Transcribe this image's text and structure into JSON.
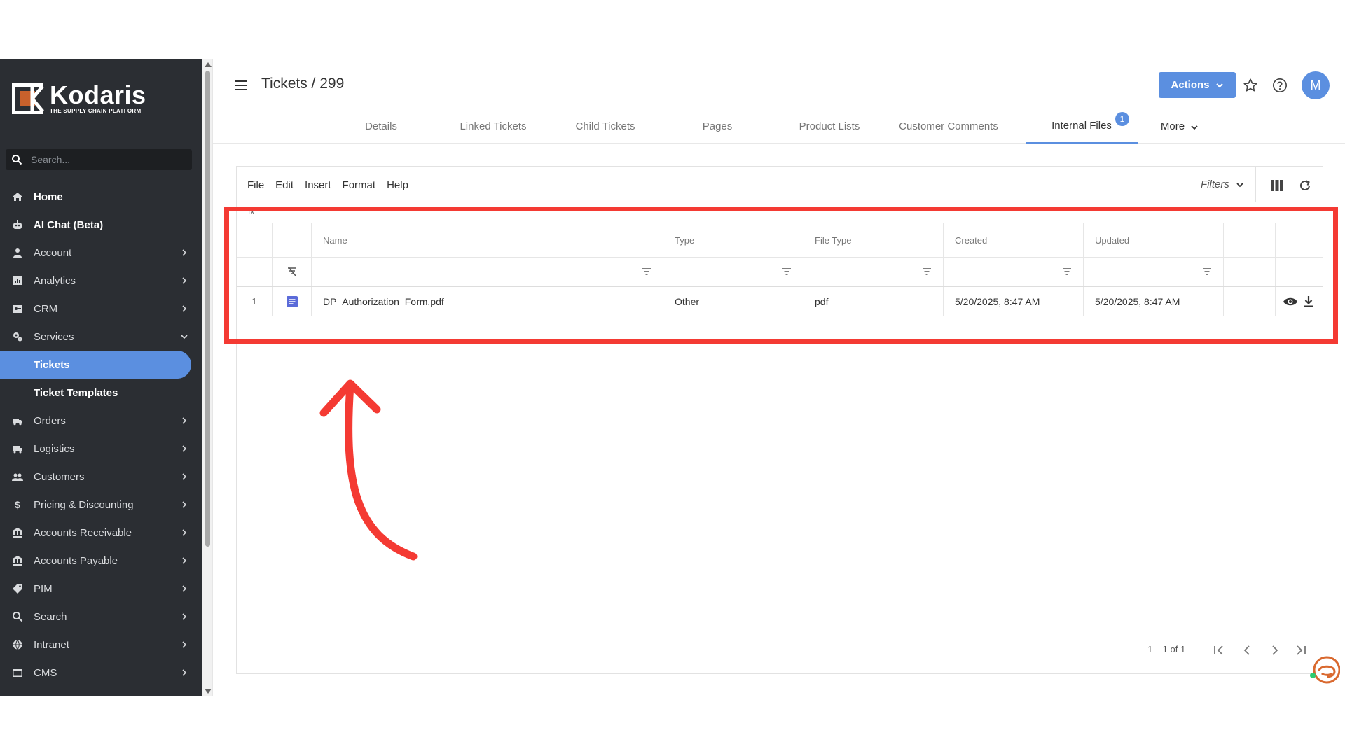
{
  "brand": {
    "name": "Kodaris",
    "tagline": "THE SUPPLY CHAIN PLATFORM",
    "accent": "#5b8fe0",
    "logo_orange": "#c8612c",
    "highlight_color": "#f43a33"
  },
  "sidebar": {
    "search_placeholder": "Search...",
    "items": [
      {
        "label": "Home",
        "icon": "home-icon",
        "chevron": false,
        "style": "bold"
      },
      {
        "label": "AI Chat (Beta)",
        "icon": "robot-icon",
        "chevron": false,
        "style": "bold"
      },
      {
        "label": "Account",
        "icon": "user-icon",
        "chevron": "right"
      },
      {
        "label": "Analytics",
        "icon": "chart-icon",
        "chevron": "right"
      },
      {
        "label": "CRM",
        "icon": "contact-card-icon",
        "chevron": "right"
      },
      {
        "label": "Services",
        "icon": "gears-icon",
        "chevron": "down"
      },
      {
        "label": "Tickets",
        "icon": null,
        "chevron": false,
        "style": "active"
      },
      {
        "label": "Ticket Templates",
        "icon": null,
        "chevron": false,
        "style": "sub"
      },
      {
        "label": "Orders",
        "icon": "truck-icon",
        "chevron": "right"
      },
      {
        "label": "Logistics",
        "icon": "shipping-icon",
        "chevron": "right"
      },
      {
        "label": "Customers",
        "icon": "users-icon",
        "chevron": "right"
      },
      {
        "label": "Pricing & Discounting",
        "icon": "dollar-icon",
        "chevron": "right"
      },
      {
        "label": "Accounts Receivable",
        "icon": "bank-icon",
        "chevron": "right"
      },
      {
        "label": "Accounts Payable",
        "icon": "bank-icon",
        "chevron": "right"
      },
      {
        "label": "PIM",
        "icon": "tag-icon",
        "chevron": "right"
      },
      {
        "label": "Search",
        "icon": "search-icon",
        "chevron": "right"
      },
      {
        "label": "Intranet",
        "icon": "globe-icon",
        "chevron": "right"
      },
      {
        "label": "CMS",
        "icon": "window-icon",
        "chevron": "right"
      }
    ]
  },
  "header": {
    "title": "Tickets / 299",
    "actions_label": "Actions",
    "avatar_initial": "M",
    "tabs": [
      {
        "label": "Details"
      },
      {
        "label": "Linked Tickets"
      },
      {
        "label": "Child Tickets"
      },
      {
        "label": "Pages"
      },
      {
        "label": "Product Lists"
      },
      {
        "label": "Customer Comments"
      },
      {
        "label": "Internal Files",
        "badge": "1",
        "active": true
      },
      {
        "label": "More",
        "dropdown": true
      }
    ]
  },
  "editor_menu": [
    "File",
    "Edit",
    "Insert",
    "Format",
    "Help"
  ],
  "toolbar": {
    "filters_label": "Filters",
    "fx_label": "fx"
  },
  "grid": {
    "columns": [
      "Name",
      "Type",
      "File Type",
      "Created",
      "Updated"
    ],
    "rows": [
      {
        "num": "1",
        "name": "DP_Authorization_Form.pdf",
        "type": "Other",
        "file_type": "pdf",
        "created": "5/20/2025, 8:47 AM",
        "updated": "5/20/2025, 8:47 AM"
      }
    ]
  },
  "pager": {
    "text": "1 – 1 of 1"
  }
}
